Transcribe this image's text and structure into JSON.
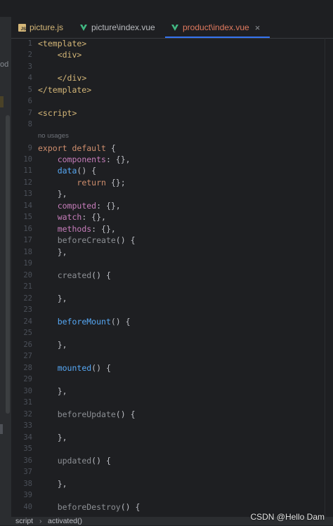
{
  "left_panel": {
    "fragment": "od"
  },
  "tabs": [
    {
      "label": "picture.js",
      "icon": "js-file-icon"
    },
    {
      "label": "picture\\index.vue",
      "icon": "vue-file-icon"
    },
    {
      "label": "product\\index.vue",
      "icon": "vue-file-icon",
      "active": true,
      "close": "×"
    }
  ],
  "inlay_hint": "no usages",
  "line_numbers": [
    "1",
    "2",
    "3",
    "4",
    "5",
    "6",
    "7",
    "8",
    "9",
    "10",
    "11",
    "12",
    "13",
    "14",
    "15",
    "16",
    "17",
    "18",
    "19",
    "20",
    "21",
    "22",
    "23",
    "24",
    "25",
    "26",
    "27",
    "28",
    "29",
    "30",
    "31",
    "32",
    "33",
    "34",
    "35",
    "36",
    "37",
    "38",
    "39",
    "40"
  ],
  "code": {
    "template_open": "<template>",
    "div_open": "<div>",
    "div_close": "</div>",
    "template_close": "</template>",
    "script_open": "<script>",
    "export_kw": "export",
    "default_kw": "default",
    "brace_open": "{",
    "components": "components",
    "components_val": ": {},",
    "data": "data",
    "data_sig": "() {",
    "return_kw": "return",
    "return_val": "{};",
    "close_comma": "},",
    "computed": "computed",
    "computed_val": ": {},",
    "watch": "watch",
    "watch_val": ": {},",
    "methods": "methods",
    "methods_val": ": {},",
    "beforeCreate": "beforeCreate",
    "created": "created",
    "beforeMount": "beforeMount",
    "mounted": "mounted",
    "beforeUpdate": "beforeUpdate",
    "updated": "updated",
    "beforeDestroy": "beforeDestroy",
    "method_sig": "() {"
  },
  "status_bar": {
    "crumb1": "script",
    "separator": "›",
    "crumb2": "activated()"
  },
  "watermark": "CSDN @Hello Dam",
  "colors": {
    "background": "#1e1f22",
    "tag": "#d5b778",
    "keyword": "#cf8e6d",
    "property": "#c77dbb",
    "function": "#56a8f5",
    "active_tab_underline": "#3574f0"
  }
}
